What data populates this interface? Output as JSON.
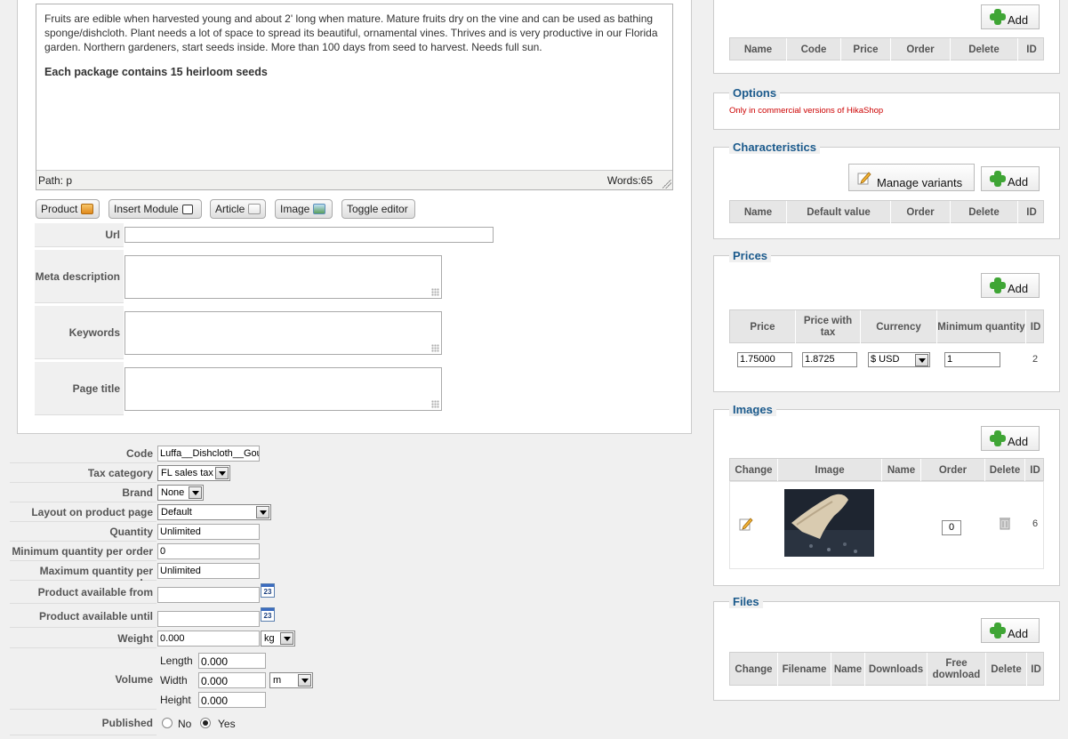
{
  "editor": {
    "paragraph": "Fruits are edible when harvested young and about 2' long when mature. Mature fruits dry on the vine and can be used as bathing sponge/dishcloth. Plant needs a lot of space to spread its beautiful, ornamental vines. Thrives and is very productive in our Florida garden. Northern gardeners, start seeds inside. More than 100 days from seed to harvest. Needs full sun.",
    "bold_line": "Each package contains 15 heirloom seeds",
    "path": "Path: p",
    "words": "Words:65"
  },
  "editor_buttons": {
    "product": "Product",
    "insert_module": "Insert Module",
    "article": "Article",
    "image": "Image",
    "toggle_editor": "Toggle editor"
  },
  "meta": {
    "url_label": "Url",
    "meta_description_label": "Meta description",
    "keywords_label": "Keywords",
    "page_title_label": "Page title"
  },
  "form": {
    "code_label": "Code",
    "code_value": "Luffa__Dishcloth__Gou",
    "tax_label": "Tax category",
    "tax_value": "FL sales tax",
    "brand_label": "Brand",
    "brand_value": "None",
    "layout_label": "Layout on product page",
    "layout_value": "Default",
    "quantity_label": "Quantity",
    "quantity_value": "Unlimited",
    "min_qty_label": "Minimum quantity per order",
    "min_qty_value": "0",
    "max_qty_label": "Maximum quantity per order",
    "max_qty_value": "Unlimited",
    "avail_from_label": "Product available from",
    "avail_until_label": "Product available until",
    "calendar_day": "23",
    "weight_label": "Weight",
    "weight_value": "0.000",
    "weight_unit": "kg",
    "volume_label": "Volume",
    "length_label": "Length",
    "length_value": "0.000",
    "width_label": "Width",
    "width_value": "0.000",
    "height_label": "Height",
    "height_value": "0.000",
    "volume_unit": "m",
    "published_label": "Published",
    "no_label": "No",
    "yes_label": "Yes",
    "published_selected": "Yes"
  },
  "add_label": "Add",
  "related": {
    "headers": [
      "Name",
      "Code",
      "Price",
      "Order",
      "Delete",
      "ID"
    ]
  },
  "options": {
    "title": "Options",
    "note": "Only in commercial versions of HikaShop"
  },
  "characteristics": {
    "title": "Characteristics",
    "manage_variants": "Manage variants",
    "headers": [
      "Name",
      "Default value",
      "Order",
      "Delete",
      "ID"
    ]
  },
  "prices": {
    "title": "Prices",
    "headers": [
      "Price",
      "Price with tax",
      "Currency",
      "Minimum quantity",
      "ID"
    ],
    "row": {
      "price": "1.75000",
      "price_with_tax": "1.8725",
      "currency": "$ USD",
      "min_qty": "1",
      "id": "2"
    }
  },
  "images": {
    "title": "Images",
    "headers": [
      "Change",
      "Image",
      "Name",
      "Order",
      "Delete",
      "ID"
    ],
    "row": {
      "order": "0",
      "id": "6"
    }
  },
  "files": {
    "title": "Files",
    "headers": [
      "Change",
      "Filename",
      "Name",
      "Downloads",
      "Free download",
      "Delete",
      "ID"
    ]
  },
  "colors": {
    "legend": "#1b5a8c",
    "plus": "#3fa535",
    "note": "#cc0000"
  }
}
